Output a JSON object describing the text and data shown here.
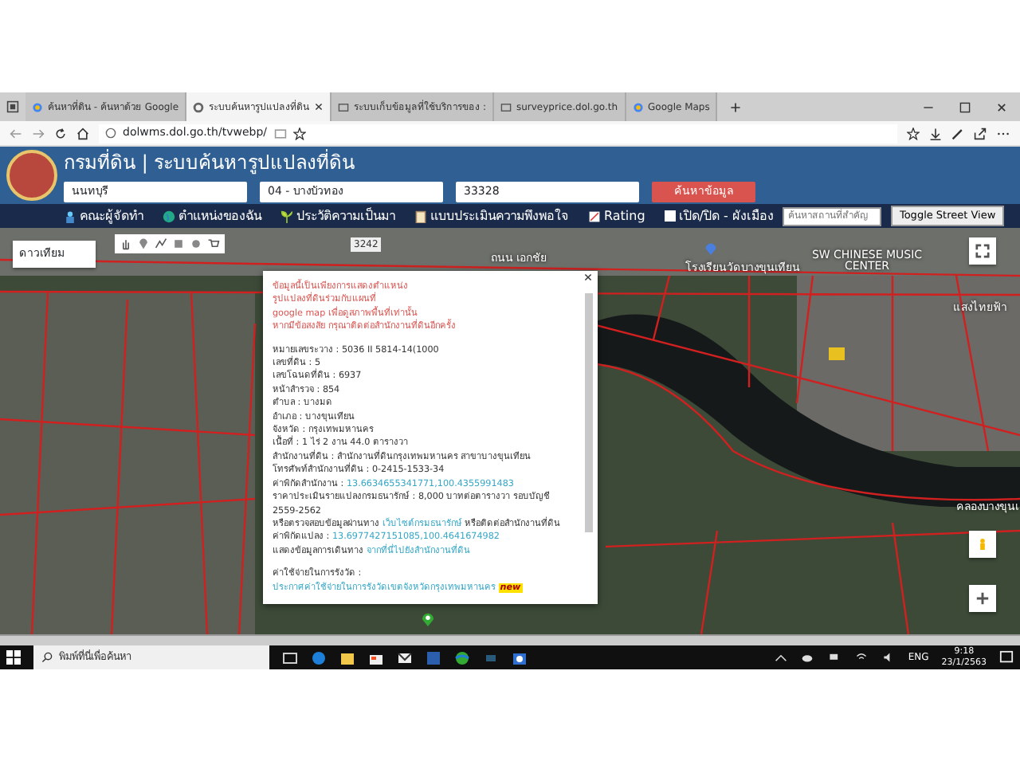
{
  "browser": {
    "tabs": [
      {
        "label": "ค้นหาที่ดิน - ค้นหาด้วย Google",
        "selected": false
      },
      {
        "label": "ระบบค้นหารูปแปลงที่ดิน",
        "selected": true
      },
      {
        "label": "ระบบเก็บข้อมูลที่ใช้บริการของ :",
        "selected": false
      },
      {
        "label": "surveyprice.dol.go.th",
        "selected": false
      },
      {
        "label": "Google Maps",
        "selected": false
      }
    ],
    "address": "dolwms.dol.go.th/tvwebp/"
  },
  "header": {
    "title": "กรมที่ดิน | ระบบค้นหารูปแปลงที่ดิน",
    "province": "นนทบุรี",
    "district": "04 - บางบัวทอง",
    "parcel_number": "33328",
    "search_button": "ค้นหาข้อมูล"
  },
  "menu": [
    {
      "label": "คณะผู้จัดทำ",
      "kind": "people"
    },
    {
      "label": "ตำแหน่งของฉัน",
      "kind": "globe"
    },
    {
      "label": "ประวัติความเป็นมา",
      "kind": "sprout"
    },
    {
      "label": "แบบประเมินความพึงพอใจ",
      "kind": "clipboard"
    },
    {
      "label": "Rating",
      "kind": "chart"
    },
    {
      "label": "เปิด/ปิด - ผังเมือง",
      "kind": "checkbox",
      "checked": false
    }
  ],
  "place_search": {
    "placeholder": "ค้นหาสถานที่สำคัญ"
  },
  "street_view_button": "Toggle Street View",
  "map": {
    "map_type": "ดาวเทียม",
    "labels": [
      {
        "text": "3242",
        "kind": "road-number"
      },
      {
        "text": "ถนน เอกชัย",
        "kind": "road"
      },
      {
        "text": "โรงเรียนวัดบางขุนเทียน",
        "kind": "place"
      },
      {
        "text": "SW CHINESE MUSIC CENTER",
        "kind": "place"
      },
      {
        "text": "แสงไทยฟ้า",
        "kind": "place"
      },
      {
        "text": "คลองบางขุนเ",
        "kind": "water"
      }
    ],
    "popup": {
      "notice": [
        "ข้อมูลนี้เป็นเพียงการแสดงตำแหน่ง",
        "รูปแปลงที่ดินร่วมกับแผนที่",
        "google map เพื่อดูสภาพพื้นที่เท่านั้น",
        "หากมีข้อสงสัย กรุณาติดต่อสำนักงานที่ดินอีกครั้ง"
      ],
      "lines": [
        {
          "parts": [
            {
              "kind": "plain",
              "text": "หมายเลขระวาง : 5036 II 5814-14(1000"
            }
          ]
        },
        {
          "parts": [
            {
              "kind": "plain",
              "text": "เลขที่ดิน : 5"
            }
          ]
        },
        {
          "parts": [
            {
              "kind": "plain",
              "text": "เลขโฉนดที่ดิน : 6937"
            }
          ]
        },
        {
          "parts": [
            {
              "kind": "plain",
              "text": "หน้าสำรวจ : 854"
            }
          ]
        },
        {
          "parts": [
            {
              "kind": "plain",
              "text": "ตำบล : บางมด"
            }
          ]
        },
        {
          "parts": [
            {
              "kind": "plain",
              "text": "อำเภอ : บางขุนเทียน"
            }
          ]
        },
        {
          "parts": [
            {
              "kind": "plain",
              "text": "จังหวัด : กรุงเทพมหานคร"
            }
          ]
        },
        {
          "parts": [
            {
              "kind": "plain",
              "text": "เนื้อที่ : 1 ไร่ 2 งาน 44.0 ตารางวา"
            }
          ]
        },
        {
          "parts": [
            {
              "kind": "plain",
              "text": "สำนักงานที่ดิน : สำนักงานที่ดินกรุงเทพมหานคร สาขาบางขุนเทียน"
            }
          ]
        },
        {
          "parts": [
            {
              "kind": "plain",
              "text": "โทรศัพท์สำนักงานที่ดิน : 0-2415-1533-34"
            }
          ]
        },
        {
          "parts": [
            {
              "kind": "plain",
              "text": "ค่าพิกัดสำนักงาน :"
            },
            {
              "kind": "link",
              "text": "13.6634655341771,100.4355991483"
            }
          ]
        },
        {
          "parts": [
            {
              "kind": "plain",
              "text": "ราคาประเมินรายแปลงกรมธนารักษ์ : 8,000 บาทต่อตารางวา รอบบัญชี 2559-2562"
            }
          ]
        },
        {
          "parts": [
            {
              "kind": "plain",
              "text": "หรือตรวจสอบข้อมูลผ่านทาง"
            },
            {
              "kind": "link",
              "text": "เว็บไซต์กรมธนารักษ์"
            },
            {
              "kind": "plain",
              "text": "หรือติดต่อสำนักงานที่ดิน"
            }
          ]
        },
        {
          "parts": [
            {
              "kind": "plain",
              "text": "ค่าพิกัดแปลง :"
            },
            {
              "kind": "link",
              "text": "13.6977427151085,100.4641674982"
            }
          ]
        },
        {
          "parts": [
            {
              "kind": "plain",
              "text": "แสดงข้อมูลการเดินทาง"
            },
            {
              "kind": "link",
              "text": "จากที่นี่ไปยังสำนักงานที่ดิน"
            }
          ]
        }
      ],
      "footer": {
        "parts": [
          {
            "kind": "plain",
            "text": "ค่าใช้จ่ายในการรังวัด :"
          },
          {
            "kind": "link",
            "text": "ประกาศค่าใช้จ่ายในการรังวัดเขตจังหวัดกรุงเทพมหานคร"
          },
          {
            "kind": "badge",
            "text": "new"
          }
        ]
      }
    }
  },
  "taskbar": {
    "search_placeholder": "พิมพ์ที่นี่เพื่อค้นหา",
    "language": "ENG",
    "time": "9:18",
    "date": "23/1/2563"
  }
}
